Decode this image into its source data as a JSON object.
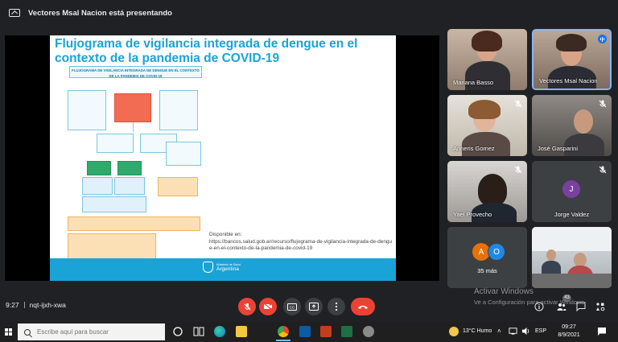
{
  "topbar": {
    "presenting_text": "Vectores Msal Nacion está presentando"
  },
  "slide": {
    "title": "Flujograma de vigilancia integrada de dengue en el contexto de la pandemia de COVID-19",
    "flow_title": "FLUJOGRAMA DE VIGILANCIA INTEGRADA DE DENGUE EN EL CONTEXTO DE LA PANDEMIA DE COVID-19",
    "available_label": "Disponible en:",
    "available_url": "https://bancos.salud.gob.ar/recurso/flujograma-de-vigilancia-integrada-de-dengue-en-el-contexto-de-la-pandemia-de-covid-19",
    "logo_small": "Ministerio de Salud",
    "logo_big": "Argentina"
  },
  "participants": [
    {
      "name": "Mariana Basso",
      "muted": false
    },
    {
      "name": "Vectores Msal Nacion",
      "muted": false,
      "speaking": true
    },
    {
      "name": "Anneris Gomez",
      "muted": true
    },
    {
      "name": "José Gasparini",
      "muted": true
    },
    {
      "name": "Yael Provecho",
      "muted": true
    },
    {
      "name": "Jorge Valdez",
      "muted": true,
      "initial": "J",
      "avatar_color": "#7b3fa0"
    }
  ],
  "more_tile": {
    "label": "35 más",
    "initials": [
      "A",
      "O"
    ],
    "colors": [
      "#e8710a",
      "#1e88e5"
    ]
  },
  "bottombar": {
    "time": "9:27",
    "meeting_code": "nqt-ijxh-xwa",
    "participants_count": "43"
  },
  "watermark": {
    "line1": "Activar Windows",
    "line2": "Ve a Configuración para activar Windows."
  },
  "taskbar": {
    "search_placeholder": "Escribe aquí para buscar",
    "weather": "13°C  Humo",
    "language": "ESP",
    "clock_time": "09:27",
    "clock_date": "8/9/2021"
  },
  "colors": {
    "accent": "#1aa3d6",
    "end_call": "#ea4335",
    "active_border": "#8ab4f8"
  },
  "icons": [
    "present-to-all-icon",
    "mic-off-icon",
    "camera-icon",
    "captions-icon",
    "present-icon",
    "more-options-icon",
    "end-call-icon",
    "info-icon",
    "people-icon",
    "chat-icon",
    "activities-icon",
    "windows-logo-icon",
    "search-icon"
  ]
}
